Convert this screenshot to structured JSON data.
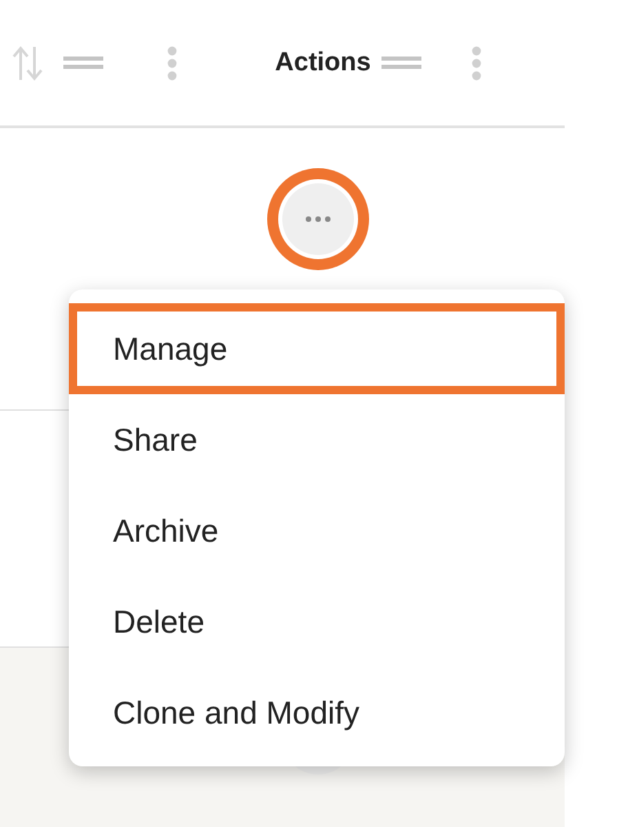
{
  "table": {
    "columns": [
      {
        "kind": "icons"
      },
      {
        "kind": "title",
        "label": "Actions"
      }
    ],
    "rows": [
      {
        "shaded": false,
        "button": {
          "focused": true
        }
      },
      {
        "shaded": false
      },
      {
        "shaded": true,
        "button": {
          "focused": false
        }
      }
    ]
  },
  "menu": {
    "items": [
      {
        "label": "Manage",
        "selected": true
      },
      {
        "label": "Share",
        "selected": false
      },
      {
        "label": "Archive",
        "selected": false
      },
      {
        "label": "Delete",
        "selected": false
      },
      {
        "label": "Clone and Modify",
        "selected": false
      }
    ]
  }
}
